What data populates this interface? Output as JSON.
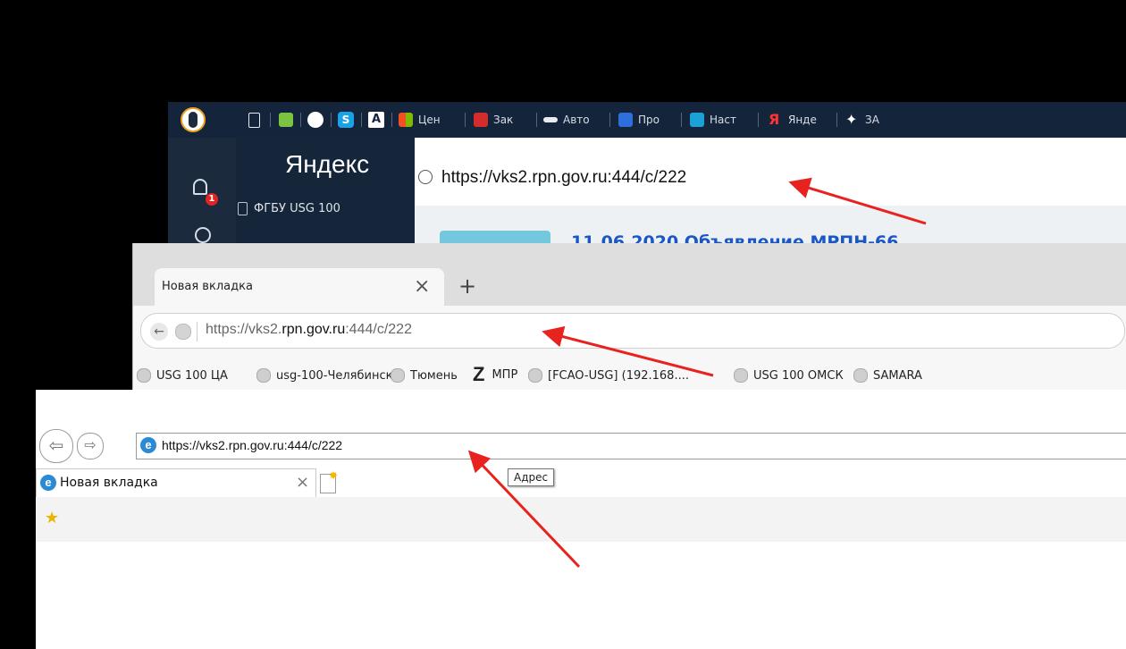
{
  "yandex": {
    "bookmarks": [
      "Цен",
      "Зак",
      "Авто",
      "Про",
      "Наст",
      "Янде",
      "ЗА"
    ],
    "bookmarks_letter_a": "A",
    "logo": "Яндекс",
    "notification_count": "1",
    "panel_item": "ФГБУ USG 100",
    "address": "https://vks2.rpn.gov.ru:444/c/222",
    "content_heading": "11.06.2020 Объявление МРПН-66"
  },
  "chrome": {
    "tab_title": "Новая вкладка",
    "tab_close": "×",
    "new_tab": "+",
    "back": "←",
    "url_prefix": "https://vks2.",
    "url_host": "rpn.gov.ru",
    "url_suffix": ":444/c/222",
    "bookmarks": [
      "USG 100 ЦА",
      "usg-100-Челябинск",
      "Тюмень",
      "МПР",
      "[FCAO-USG] (192.168....",
      "USG 100 ОМСК",
      "SAMARA"
    ],
    "bookmark_z": "Z"
  },
  "ie": {
    "back": "⇦",
    "forward": "⇨",
    "address": "https://vks2.rpn.gov.ru:444/c/222",
    "tooltip": "Адрес",
    "tab_title": "Новая вкладка",
    "tab_close": "×",
    "e_glyph": "e",
    "favorites_icon": "★"
  }
}
